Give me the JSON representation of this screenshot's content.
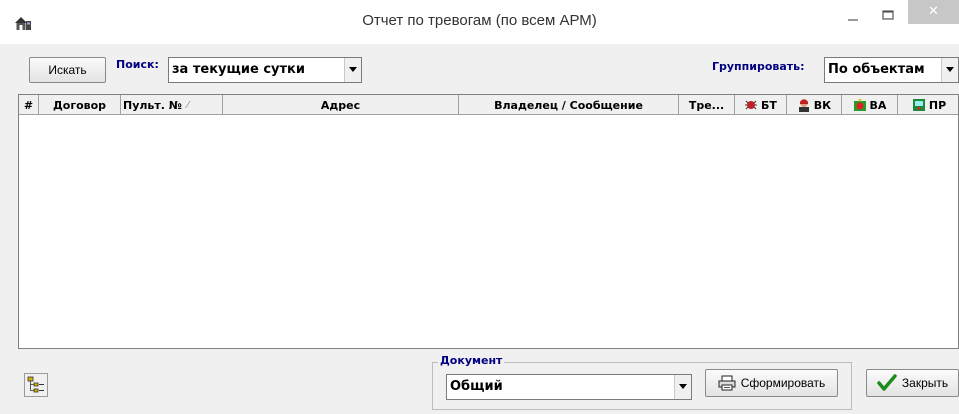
{
  "window": {
    "title": "Отчет по тревогам (по всем АРМ)",
    "icon": "home-network-icon",
    "close_glyph": "✕"
  },
  "toolbar": {
    "search_button": "Искать",
    "search_label": "Поиск:",
    "period_value": "за текущие сутки",
    "group_label": "Группировать:",
    "group_value": "По объектам"
  },
  "grid": {
    "columns": [
      {
        "label": "#"
      },
      {
        "label": "Договор"
      },
      {
        "label": "Пульт. №",
        "sort_glyph": "⁄"
      },
      {
        "label": "Адрес"
      },
      {
        "label": "Владелец / Сообщение"
      },
      {
        "label": "Тре..."
      },
      {
        "label": "БТ",
        "icon": "alarm-bell-icon"
      },
      {
        "label": "ВК",
        "icon": "person-icon"
      },
      {
        "label": "ВА",
        "icon": "fire-icon"
      },
      {
        "label": "ПР",
        "icon": "device-icon"
      }
    ],
    "rows": []
  },
  "document": {
    "legend": "Документ",
    "value": "Общий",
    "generate_button": "Сформировать"
  },
  "footer": {
    "close_button": "Закрыть"
  },
  "colors": {
    "label_blue": "#000080",
    "window_bg": "#f0f0f0",
    "check_green": "#1c8c1c"
  }
}
